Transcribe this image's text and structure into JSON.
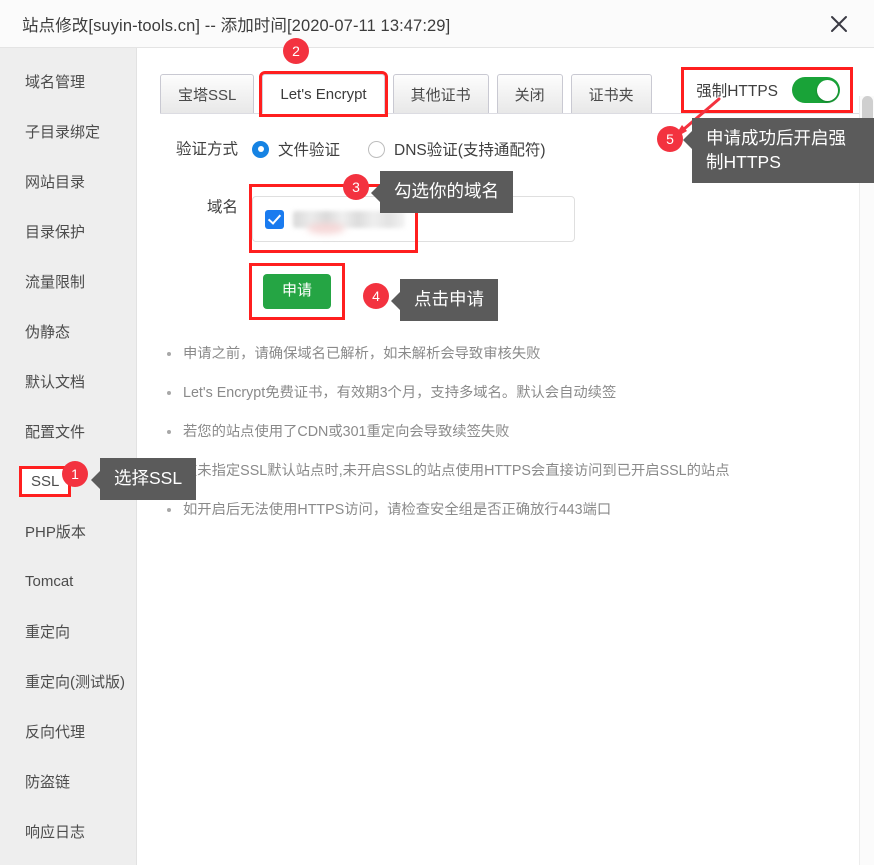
{
  "window": {
    "title": "站点修改[suyin-tools.cn] -- 添加时间[2020-07-11 13:47:29]",
    "close_label": "×"
  },
  "sidebar": {
    "items": [
      {
        "label": "域名管理",
        "highlighted": false
      },
      {
        "label": "子目录绑定",
        "highlighted": false
      },
      {
        "label": "网站目录",
        "highlighted": false
      },
      {
        "label": "目录保护",
        "highlighted": false
      },
      {
        "label": "流量限制",
        "highlighted": false
      },
      {
        "label": "伪静态",
        "highlighted": false
      },
      {
        "label": "默认文档",
        "highlighted": false
      },
      {
        "label": "配置文件",
        "highlighted": false
      },
      {
        "label": "SSL",
        "highlighted": true
      },
      {
        "label": "PHP版本",
        "highlighted": false
      },
      {
        "label": "Tomcat",
        "highlighted": false
      },
      {
        "label": "重定向",
        "highlighted": false
      },
      {
        "label": "重定向(测试版)",
        "highlighted": false
      },
      {
        "label": "反向代理",
        "highlighted": false
      },
      {
        "label": "防盗链",
        "highlighted": false
      },
      {
        "label": "响应日志",
        "highlighted": false
      }
    ]
  },
  "tabs": [
    {
      "label": "宝塔SSL",
      "active": false,
      "boxed": false
    },
    {
      "label": "Let's Encrypt",
      "active": true,
      "boxed": true
    },
    {
      "label": "其他证书",
      "active": false,
      "boxed": false
    },
    {
      "label": "关闭",
      "active": false,
      "boxed": false
    },
    {
      "label": "证书夹",
      "active": false,
      "boxed": false
    }
  ],
  "force_https": {
    "label": "强制HTTPS",
    "enabled": true
  },
  "form": {
    "verify_label": "验证方式",
    "verify_options": [
      {
        "label": "文件验证",
        "selected": true
      },
      {
        "label": "DNS验证(支持通配符)",
        "selected": false
      }
    ],
    "domain_label": "域名",
    "domain_checked": true,
    "domain_value": "",
    "apply_label": "申请"
  },
  "notes": [
    "申请之前，请确保域名已解析，如未解析会导致审核失败",
    "Let's Encrypt免费证书，有效期3个月，支持多域名。默认会自动续签",
    "若您的站点使用了CDN或301重定向会导致续签失败",
    "在未指定SSL默认站点时,未开启SSL的站点使用HTTPS会直接访问到已开启SSL的站点",
    "如开启后无法使用HTTPS访问，请检查安全组是否正确放行443端口"
  ],
  "annotations": [
    {
      "number": "1",
      "text": "选择SSL"
    },
    {
      "number": "2",
      "text": ""
    },
    {
      "number": "3",
      "text": "勾选你的域名"
    },
    {
      "number": "4",
      "text": "点击申请"
    },
    {
      "number": "5",
      "text": "申请成功后开启强制HTTPS"
    }
  ],
  "colors": {
    "accent_red": "#f3323f",
    "highlight_box": "#ff1f1f",
    "toggle_green": "#19a338",
    "apply_green": "#25a544",
    "checkbox_blue": "#1a7bef",
    "radio_blue": "#1683e3",
    "tooltip_gray": "#5b5b5b"
  }
}
